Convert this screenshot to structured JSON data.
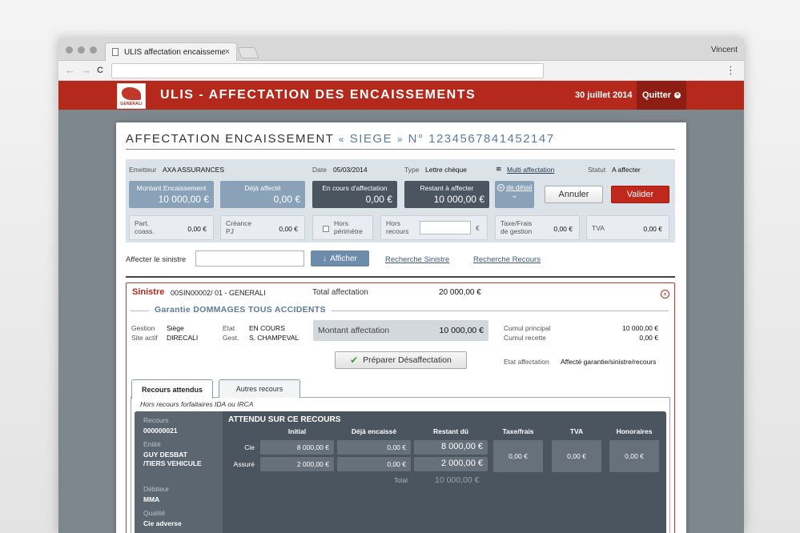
{
  "browser": {
    "tab_title": "ULIS affectation encaissement",
    "tab_close": "×",
    "user": "Vincent",
    "back": "←",
    "forward": "→",
    "reload": "C",
    "menu": "⋮"
  },
  "header": {
    "logo_text": "GENERALI",
    "title": "ULIS - AFFECTATION DES ENCAISSEMENTS",
    "date": "30 juillet 2014",
    "quit_label": "Quitter",
    "quit_icon": "×"
  },
  "page": {
    "title_main": "AFFECTATION ENCAISSEMENT",
    "title_open": "«",
    "title_entity": "SIEGE",
    "title_close": "»",
    "title_num": "N° 1234567841452147"
  },
  "info": {
    "emetteur_label": "Emetteur",
    "emetteur_value": "AXA ASSURANCES",
    "date_label": "Date",
    "date_value": "05/03/2014",
    "type_label": "Type",
    "type_value": "Lettre chèque",
    "multi_link": "Multi affectation",
    "statut_label": "Statut",
    "statut_value": "A affecter",
    "amounts": [
      {
        "label": "Montant Encaissement",
        "value": "10 000,00 €"
      },
      {
        "label": "Déjà affecté",
        "value": "0,00 €"
      },
      {
        "label": "En cours d'affectation",
        "value": "0,00 €"
      },
      {
        "label": "Restant à affecter",
        "value": "10 000,00 €"
      }
    ],
    "detail_plus": "+",
    "detail_label": "de détail",
    "detail_chevron": "⌄",
    "annuler": "Annuler",
    "valider": "Valider",
    "cells": [
      {
        "label1": "Part.",
        "label2": "coass.",
        "value": "0,00 €"
      },
      {
        "label1": "Créance",
        "label2": "PJ",
        "value": "0,00 €"
      },
      {
        "label1": "Hors",
        "label2": "périmètre",
        "value": ""
      },
      {
        "label1": "Hors",
        "label2": "recours",
        "value": "€"
      },
      {
        "label1": "Taxe/Frais",
        "label2": "de gestion",
        "value": "0,00 €"
      },
      {
        "label1": "TVA",
        "label2": "",
        "value": "0,00 €"
      }
    ]
  },
  "search": {
    "label": "Affecter le sinistre",
    "input_value": "",
    "afficher_icon": "↓",
    "afficher": "Afficher",
    "link_sinistre": "Recherche Sinistre",
    "link_recours": "Recherche Recours"
  },
  "sinistre": {
    "title": "Sinistre",
    "ref": "00SIN00002/ 01 - GENERALI",
    "total_label": "Total affectation",
    "total_value": "20 000,00 €",
    "close_icon": "×",
    "garantie": "Garantie DOMMAGES TOUS ACCIDENTS",
    "gestion_label": "Gestion",
    "gestion_value": "Siège",
    "site_label": "Site actif",
    "site_value": "DIRECALI",
    "etat_label": "Etat",
    "etat_value": "EN COURS",
    "gest_label": "Gest.",
    "gest_value": "S. CHAMPEVAL",
    "montant_label": "Montant affectation",
    "montant_value": "10 000,00 €",
    "cumul_principal_label": "Cumul principal",
    "cumul_principal_value": "10 000,00 €",
    "cumul_recette_label": "Cumul recette",
    "cumul_recette_value": "0,00 €",
    "preparer_icon": "✔",
    "preparer": "Préparer Désaffectation",
    "etat_aff_label": "Etat affectation",
    "etat_aff_value": "Affecté garantie/sinistre/recours"
  },
  "recours": {
    "tab_active": "Recours attendus",
    "tab_other": "Autres recours",
    "subtitle": "Hors recours forfaitaires IDA ou IRCA",
    "recours_label": "Recours",
    "recours_value": "000000021",
    "entite_label": "Entité",
    "entite_line1": "GUY DESBAT",
    "entite_line2": "/TIERS VEHICULE",
    "debiteur_label": "Débiteur",
    "debiteur_value": "MMA",
    "qualite_label": "Qualité",
    "qualite_value": "Cie adverse",
    "heading": "ATTENDU SUR CE RECOURS",
    "col_initial": "Initial",
    "col_deja": "Déjà encaissé",
    "col_restant": "Restant dû",
    "col_taxe": "Taxe/frais",
    "col_tva": "TVA",
    "col_honoraires": "Honoraires",
    "rows": [
      {
        "label": "Cie",
        "initial": "8 000,00 €",
        "deja": "0,00 €",
        "restant": "8 000,00 €"
      },
      {
        "label": "Assuré",
        "initial": "2 000,00 €",
        "deja": "0,00 €",
        "restant": "2 000,00 €"
      }
    ],
    "taxe_value": "0,00 €",
    "tva_value": "0,00 €",
    "honoraires_value": "0,00 €",
    "total_label": "Total",
    "total_value": "10 000,00 €"
  }
}
